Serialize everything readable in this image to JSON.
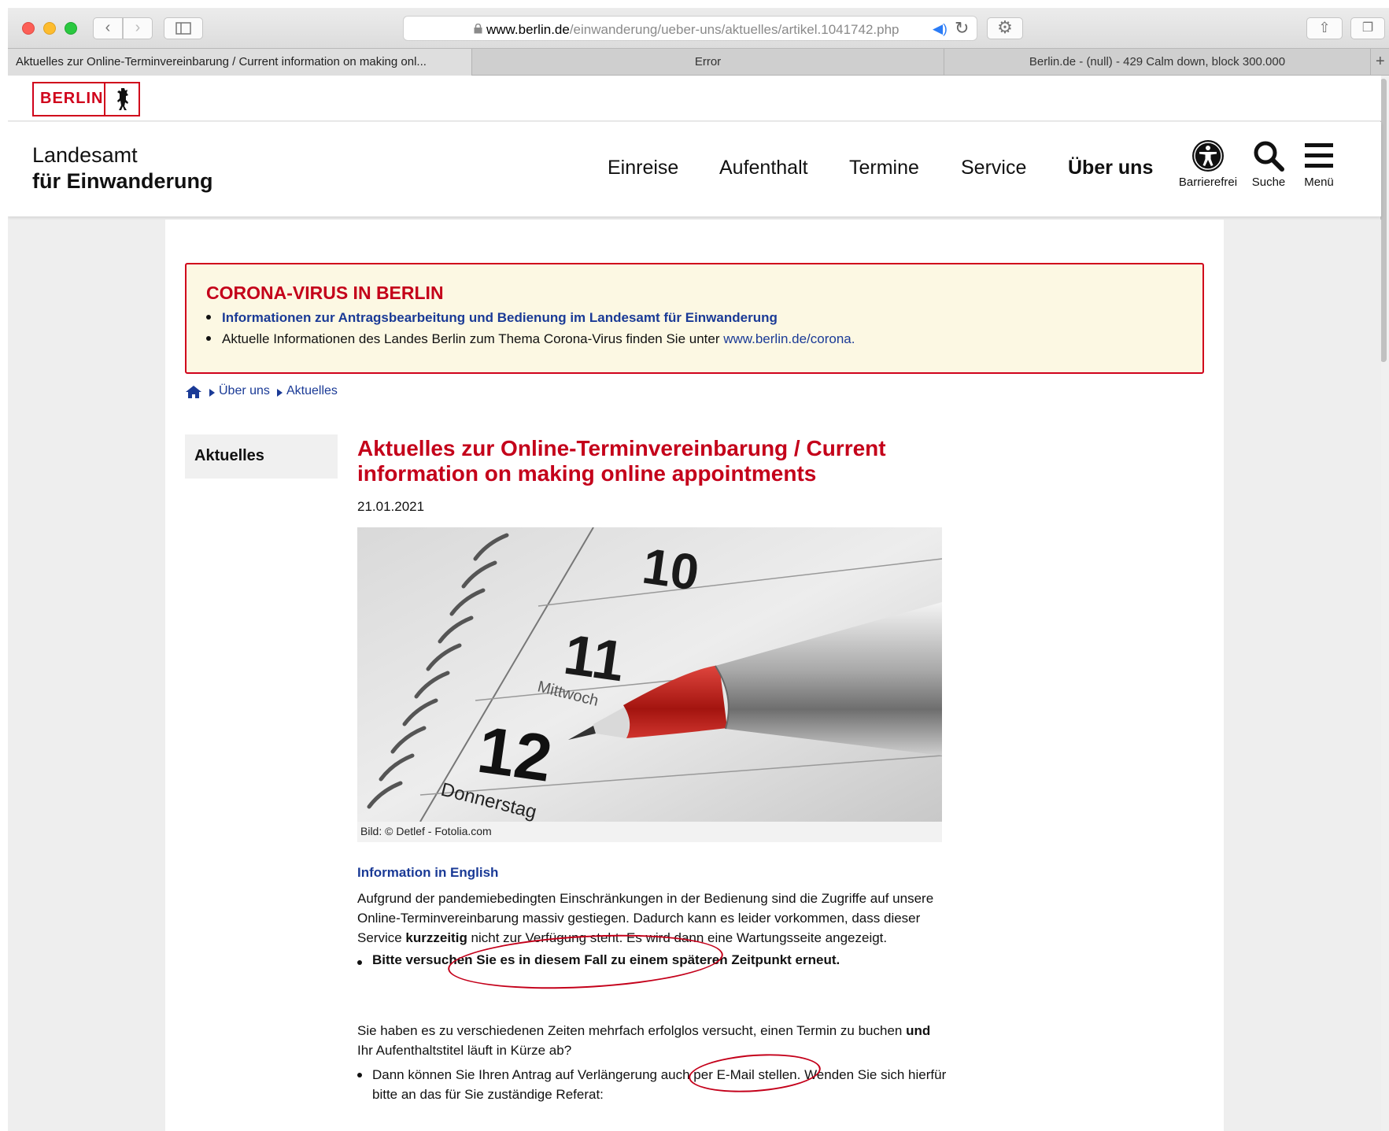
{
  "browser": {
    "url_domain": "www.berlin.de",
    "url_path": "/einwanderung/ueber-uns/aktuelles/artikel.1041742.php",
    "tabs": [
      {
        "label": "Aktuelles zur Online-Terminvereinbarung / Current information on making onl..."
      },
      {
        "label": "Error"
      },
      {
        "label": "Berlin.de - (null) - 429 Calm down, block 300.000"
      }
    ],
    "new_tab": "+"
  },
  "brand": {
    "logo_text": "BERLIN",
    "site_title_line1": "Landesamt",
    "site_title_line2": "für Einwanderung"
  },
  "nav": {
    "items": [
      {
        "label": "Einreise"
      },
      {
        "label": "Aufenthalt"
      },
      {
        "label": "Termine"
      },
      {
        "label": "Service"
      },
      {
        "label": "Über uns"
      }
    ],
    "utilities": {
      "barrierefrei": "Barrierefrei",
      "suche": "Suche",
      "menu": "Menü"
    }
  },
  "corona": {
    "title": "CORONA-VIRUS IN BERLIN",
    "item1_link": "Informationen zur Antragsbearbeitung und Bedienung im Landesamt für Einwanderung",
    "item2_text": "Aktuelle Informationen des Landes Berlin zum Thema Corona-Virus finden Sie unter ",
    "item2_link": "www.berlin.de/corona."
  },
  "breadcrumb": {
    "items": [
      "Über uns",
      "Aktuelles"
    ]
  },
  "sidebar": {
    "active_item": "Aktuelles"
  },
  "article": {
    "title": "Aktuelles zur Online-Terminvereinbarung / Current information on making online appointments",
    "date": "21.01.2021",
    "image_caption": "Bild: © Detlef - Fotolia.com",
    "image_calendar": {
      "day_10": "10",
      "day_11": "11",
      "day_11_name": "Mittwoch",
      "day_12": "12",
      "day_12_name": "Donnerstag"
    },
    "info_english_link": "Information in English",
    "para1_a": "Aufgrund der pandemiebedingten Einschränkungen in der Bedienung sind die Zugriffe auf unsere Online-Terminvereinbarung massiv gestiegen. Dadurch kann es leider vorkommen, dass dieser Service ",
    "para1_bold": "kurzzeitig",
    "para1_b": " nicht zur Verfügung steht. Es wird dann eine Wartungsseite angezeigt.",
    "bullet1": "Bitte versuchen Sie es in diesem Fall zu einem späteren Zeitpunkt erneut.",
    "para2_a": "Sie haben es zu verschiedenen Zeiten mehrfach erfolglos versucht, einen Termin zu buchen ",
    "para2_bold": "und",
    "para2_b": " Ihr Aufenthaltstitel läuft in Kürze ab?",
    "bullet2": "Dann können Sie Ihren Antrag auf Verlängerung auch per E-Mail stellen. Wenden Sie sich hierfür bitte an das für Sie zuständige Referat:"
  },
  "colors": {
    "berlin_red": "#d0021b",
    "link_blue": "#1a3a96",
    "notice_bg": "#fcf8e3"
  }
}
